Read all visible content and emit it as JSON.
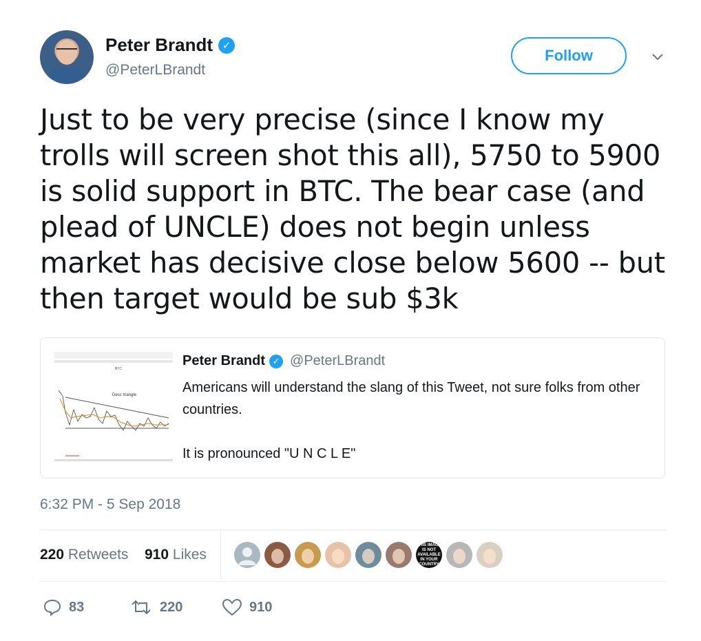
{
  "author": {
    "name": "Peter Brandt",
    "handle": "@PeterLBrandt",
    "verified_symbol": "✓"
  },
  "follow_button": {
    "label": "Follow"
  },
  "menu_icon": "chevron-down-icon",
  "tweet": {
    "text": "Just to be very precise (since I know my trolls will screen shot this all), 5750 to 5900 is solid support in BTC. The bear case (and plead of UNCLE) does not begin unless market has decisive close below 5600 -- but then target would be sub $3k",
    "timestamp": "6:32 PM - 5 Sep 2018"
  },
  "quoted_tweet": {
    "name": "Peter Brandt",
    "handle": "@PeterLBrandt",
    "line1": "Americans will understand the slang of this Tweet, not sure folks from other countries.",
    "line2": "It is pronounced \"U N C L E\"",
    "thumb_label": "BTC",
    "thumb_annotation": "Desc triangle"
  },
  "stats": {
    "retweets_count": "220",
    "retweets_label": "Retweets",
    "likes_count": "910",
    "likes_label": "Likes"
  },
  "liker_avatars": [
    {
      "name": "default-avatar",
      "color": "#aab8c2"
    },
    {
      "name": "avatar-2",
      "color": "#8a5a44"
    },
    {
      "name": "avatar-3",
      "color": "#c79a4d"
    },
    {
      "name": "avatar-4",
      "color": "#e8c2a8"
    },
    {
      "name": "avatar-5",
      "color": "#6f8c9c"
    },
    {
      "name": "avatar-6",
      "color": "#9a7a6e"
    },
    {
      "name": "avatar-7",
      "color": "#111111",
      "text": "THIS IMAGE IS NOT AVAILABLE IN YOUR COUNTRY"
    },
    {
      "name": "avatar-8",
      "color": "#b7b7b7"
    },
    {
      "name": "avatar-9",
      "color": "#d9d0c2"
    }
  ],
  "actions": {
    "reply_count": "83",
    "retweet_count": "220",
    "like_count": "910"
  },
  "colors": {
    "accent": "#1da1f2",
    "secondary_text": "#657786",
    "primary_text": "#14171a",
    "border": "#e1e8ed"
  }
}
